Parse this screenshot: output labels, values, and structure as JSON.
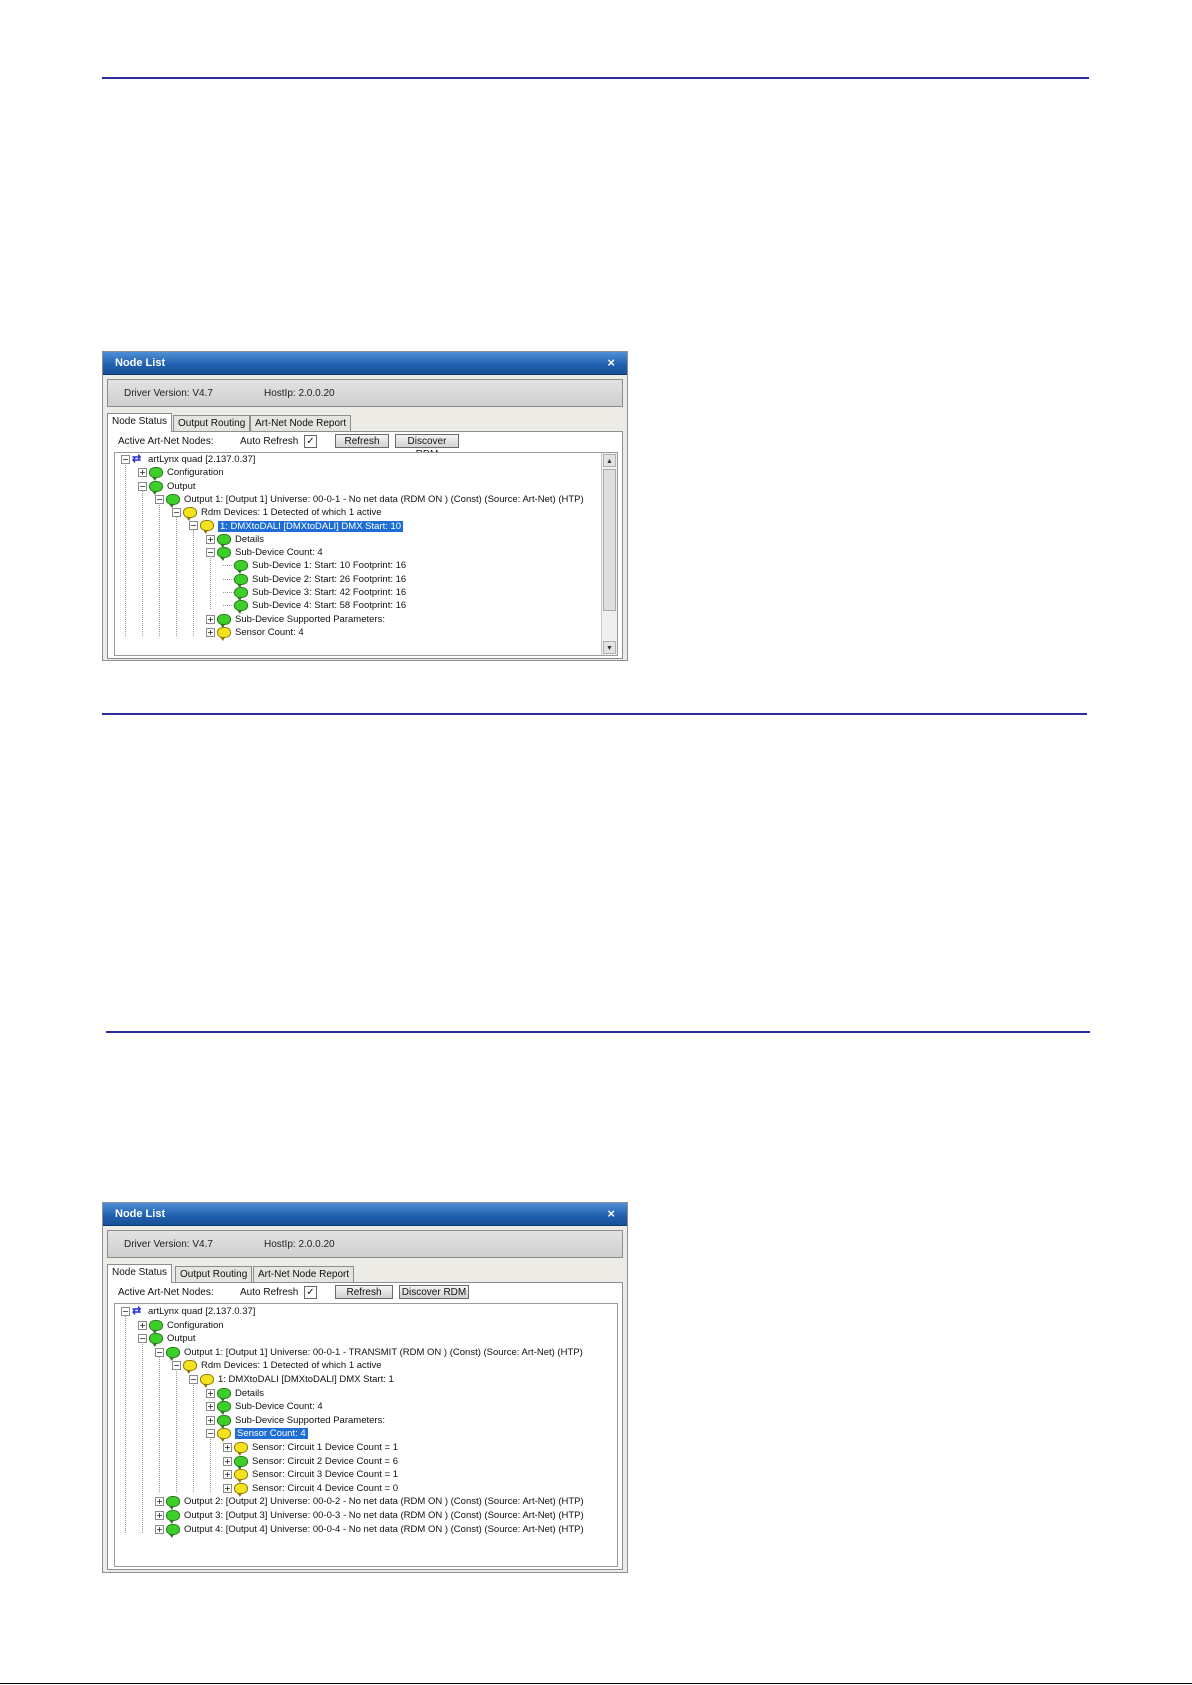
{
  "window1": {
    "title": "Node List",
    "close": "×",
    "driver_version": "Driver Version: V4.7",
    "host_ip": "HostIp: 2.0.0.20",
    "tabs": [
      "Node Status",
      "Output Routing",
      "Art-Net Node Report"
    ],
    "active_nodes_label": "Active Art-Net Nodes:",
    "auto_refresh_label": "Auto Refresh",
    "auto_refresh_checked": "✓",
    "refresh_button": "Refresh",
    "discover_button": "Discover RDM",
    "tree": [
      {
        "text": "artLynx quad [2.137.0.37]",
        "icon": "net",
        "box": "−"
      },
      {
        "text": "Configuration",
        "icon": "g",
        "box": "+"
      },
      {
        "text": "Output",
        "icon": "g",
        "box": "−"
      },
      {
        "text": "Output 1: [Output 1] Universe: 00-0-1  - No net data (RDM ON  ) (Const) (Source: Art-Net) (HTP)",
        "icon": "g",
        "box": "−"
      },
      {
        "text": "Rdm Devices: 1 Detected of which 1 active",
        "icon": "y",
        "box": "−"
      },
      {
        "text": "1: DMXtoDALI [DMXtoDALI] DMX Start: 10",
        "icon": "y",
        "box": "−",
        "selected": true
      },
      {
        "text": "Details",
        "icon": "g",
        "box": "+"
      },
      {
        "text": "Sub-Device Count: 4",
        "icon": "g",
        "box": "−"
      },
      {
        "text": "Sub-Device 1: Start: 10 Footprint: 16",
        "icon": "g",
        "box": ""
      },
      {
        "text": "Sub-Device 2: Start: 26 Footprint: 16",
        "icon": "g",
        "box": ""
      },
      {
        "text": "Sub-Device 3: Start: 42 Footprint: 16",
        "icon": "g",
        "box": ""
      },
      {
        "text": "Sub-Device 4: Start: 58 Footprint: 16",
        "icon": "g",
        "box": ""
      },
      {
        "text": "Sub-Device Supported Parameters:",
        "icon": "g",
        "box": "+"
      },
      {
        "text": "Sensor Count: 4",
        "icon": "y",
        "box": "+"
      }
    ]
  },
  "window2": {
    "title": "Node List",
    "close": "×",
    "driver_version": "Driver Version: V4.7",
    "host_ip": "HostIp: 2.0.0.20",
    "tabs": [
      "Node Status",
      "Output Routing",
      "Art-Net Node Report"
    ],
    "active_nodes_label": "Active Art-Net Nodes:",
    "auto_refresh_label": "Auto Refresh",
    "auto_refresh_checked": "✓",
    "refresh_button": "Refresh",
    "discover_button": "Discover RDM",
    "tree": [
      {
        "text": "artLynx quad [2.137.0.37]",
        "icon": "net",
        "box": "−"
      },
      {
        "text": "Configuration",
        "icon": "g",
        "box": "+"
      },
      {
        "text": "Output",
        "icon": "g",
        "box": "−"
      },
      {
        "text": "Output 1: [Output 1] Universe: 00-0-1  - TRANSMIT  (RDM ON  ) (Const) (Source: Art-Net) (HTP)",
        "icon": "g",
        "box": "−"
      },
      {
        "text": "Rdm Devices: 1 Detected of which 1 active",
        "icon": "y",
        "box": "−"
      },
      {
        "text": "1: DMXtoDALI [DMXtoDALI] DMX Start: 1",
        "icon": "y",
        "box": "−"
      },
      {
        "text": "Details",
        "icon": "g",
        "box": "+"
      },
      {
        "text": "Sub-Device Count: 4",
        "icon": "g",
        "box": "+"
      },
      {
        "text": "Sub-Device Supported Parameters:",
        "icon": "g",
        "box": "+"
      },
      {
        "text": "Sensor Count: 4",
        "icon": "y",
        "box": "−",
        "selected": true
      },
      {
        "text": "Sensor:  Circuit 1 Device Count = 1",
        "icon": "y",
        "box": "+"
      },
      {
        "text": "Sensor:  Circuit 2 Device Count = 6",
        "icon": "g",
        "box": "+"
      },
      {
        "text": "Sensor:  Circuit 3 Device Count = 1",
        "icon": "y",
        "box": "+"
      },
      {
        "text": "Sensor:  Circuit 4 Device Count = 0",
        "icon": "y",
        "box": "+"
      },
      {
        "text": "Output 2: [Output 2] Universe: 00-0-2  - No net data (RDM ON  ) (Const) (Source: Art-Net) (HTP)",
        "icon": "g",
        "box": "+"
      },
      {
        "text": "Output 3: [Output 3] Universe: 00-0-3  - No net data (RDM ON  ) (Const) (Source: Art-Net) (HTP)",
        "icon": "g",
        "box": "+"
      },
      {
        "text": "Output 4: [Output 4] Universe: 00-0-4  - No net data (RDM ON  ) (Const) (Source: Art-Net) (HTP)",
        "icon": "g",
        "box": "+"
      }
    ]
  }
}
